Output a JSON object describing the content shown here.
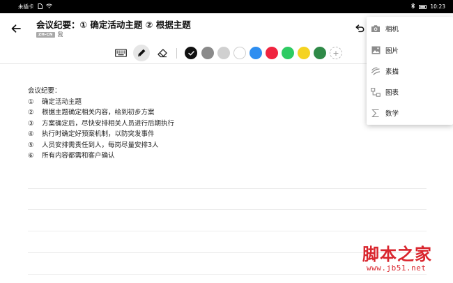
{
  "status_bar": {
    "carrier": "未插卡",
    "time": "10:23"
  },
  "header": {
    "title": "会议纪要：① 确定活动主题 ② 根据主题",
    "language_badge": "ZH-CN",
    "author": "我"
  },
  "toolbar": {
    "tools": [
      "keyboard-icon",
      "pen-icon",
      "eraser-icon"
    ],
    "active_tool": "pen",
    "colors": [
      "#111111",
      "#8a8a8a",
      "#d0d0d0",
      "#ffffff",
      "#2e8ef0",
      "#f0243f",
      "#2ecb63",
      "#f5d321",
      "#2f8a48"
    ],
    "selected_color": "#111111",
    "add_color_label": "+"
  },
  "note": {
    "heading": "会议纪要：",
    "items": [
      {
        "num": "①",
        "text": "确定活动主题"
      },
      {
        "num": "②",
        "text": "根据主题确定相关内容，给到初步方案"
      },
      {
        "num": "③",
        "text": "方案确定后，尽快安排相关人员进行后期执行"
      },
      {
        "num": "④",
        "text": "执行时确定好预案机制，以防突发事件"
      },
      {
        "num": "⑤",
        "text": "人员安排需责任到人，每岗尽量安排3人"
      },
      {
        "num": "⑥",
        "text": "所有内容都需和客户确认"
      }
    ]
  },
  "insert_menu": {
    "items": [
      {
        "icon": "camera-icon",
        "label": "相机"
      },
      {
        "icon": "image-icon",
        "label": "图片"
      },
      {
        "icon": "sketch-icon",
        "label": "素描"
      },
      {
        "icon": "chart-icon",
        "label": "图表"
      },
      {
        "icon": "sigma-icon",
        "label": "数学"
      }
    ]
  },
  "watermark": {
    "text": "脚本之家",
    "url": "www.jb51.net"
  }
}
